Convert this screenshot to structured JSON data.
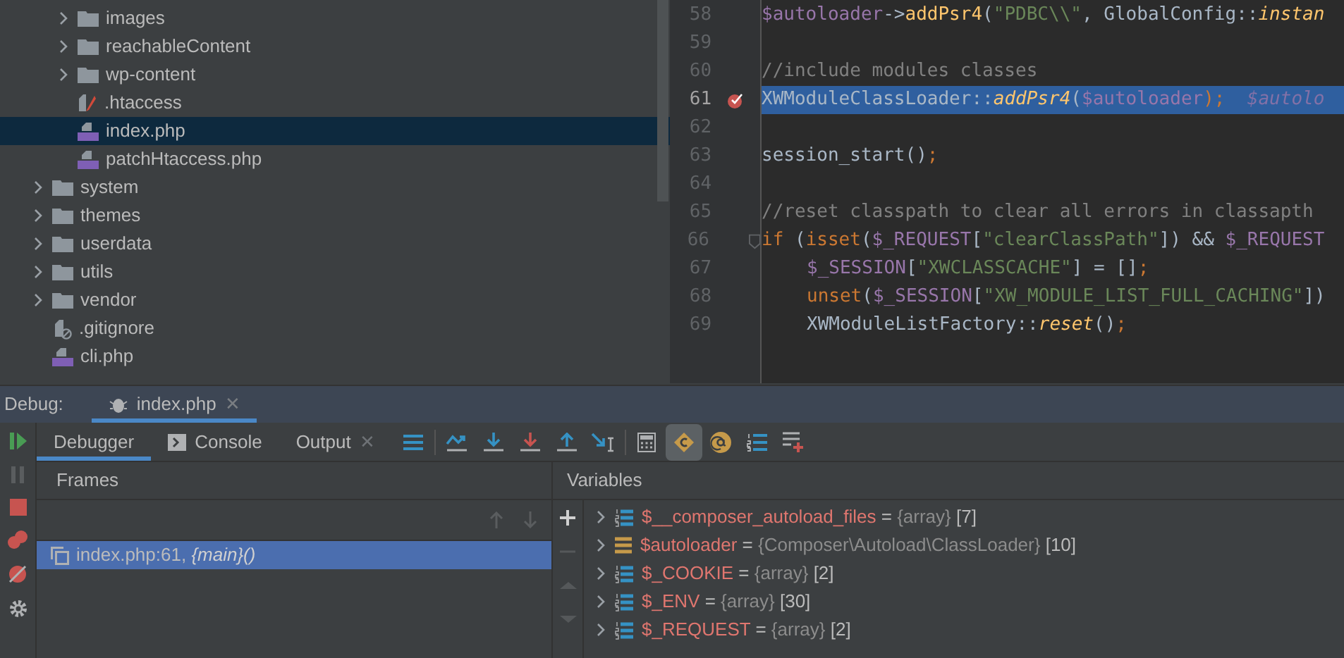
{
  "project_tree": {
    "inner_items": [
      {
        "label": "images",
        "kind": "folder",
        "expanded": false,
        "selected": false
      },
      {
        "label": "reachableContent",
        "kind": "folder",
        "expanded": false,
        "selected": false
      },
      {
        "label": "wp-content",
        "kind": "folder",
        "expanded": false,
        "selected": false
      },
      {
        "label": ".htaccess",
        "kind": "apache",
        "selected": false
      },
      {
        "label": "index.php",
        "kind": "php",
        "selected": true
      },
      {
        "label": "patchHtaccess.php",
        "kind": "php",
        "selected": false
      }
    ],
    "items": [
      {
        "label": "system",
        "kind": "folder",
        "expanded": false,
        "selected": false
      },
      {
        "label": "themes",
        "kind": "folder",
        "expanded": false,
        "selected": false
      },
      {
        "label": "userdata",
        "kind": "folder",
        "expanded": false,
        "selected": false
      },
      {
        "label": "utils",
        "kind": "folder",
        "expanded": false,
        "selected": false
      },
      {
        "label": "vendor",
        "kind": "folder",
        "expanded": false,
        "selected": false
      },
      {
        "label": ".gitignore",
        "kind": "ignore",
        "selected": false
      },
      {
        "label": "cli.php",
        "kind": "php",
        "selected": false
      }
    ]
  },
  "editor": {
    "lines": [
      {
        "number": "58",
        "current": false,
        "breakpoint": false,
        "fold": false,
        "indent": false,
        "tokens": [
          {
            "text": "$autoloader",
            "kind": "var"
          },
          {
            "text": "->",
            "kind": "plain"
          },
          {
            "text": "addPsr4",
            "kind": "call"
          },
          {
            "text": "(",
            "kind": "plain"
          },
          {
            "text": "\"PDBC\\\\\"",
            "kind": "string"
          },
          {
            "text": ", GlobalConfig::",
            "kind": "plain"
          },
          {
            "text": "instan",
            "kind": "func"
          }
        ]
      },
      {
        "number": "59",
        "current": false,
        "breakpoint": false,
        "fold": false
      },
      {
        "number": "60",
        "current": false,
        "breakpoint": false,
        "fold": false,
        "indent": false,
        "tokens": [
          {
            "text": "//include modules classes",
            "kind": "comment"
          }
        ]
      },
      {
        "number": "61",
        "current": true,
        "breakpoint": true,
        "fold": false,
        "indent": false,
        "tokens": [
          {
            "text": "XWModuleClassLoader::",
            "kind": "plain"
          },
          {
            "text": "addPsr4",
            "kind": "func"
          },
          {
            "text": "(",
            "kind": "plain"
          },
          {
            "text": "$autoloader",
            "kind": "var"
          },
          {
            "text": ");",
            "kind": "keyword"
          },
          {
            "text": "  $autolo",
            "kind": "hint"
          }
        ]
      },
      {
        "number": "62",
        "current": false,
        "breakpoint": false,
        "fold": false
      },
      {
        "number": "63",
        "current": false,
        "breakpoint": false,
        "fold": false,
        "indent": false,
        "tokens": [
          {
            "text": "session_start()",
            "kind": "plain"
          },
          {
            "text": ";",
            "kind": "keyword"
          }
        ]
      },
      {
        "number": "64",
        "current": false,
        "breakpoint": false,
        "fold": false
      },
      {
        "number": "65",
        "current": false,
        "breakpoint": false,
        "fold": false,
        "indent": false,
        "tokens": [
          {
            "text": "//reset classpath to clear all errors in classapth",
            "kind": "comment"
          }
        ]
      },
      {
        "number": "66",
        "current": false,
        "breakpoint": false,
        "fold": true,
        "indent": false,
        "tokens": [
          {
            "text": "if ",
            "kind": "keyword"
          },
          {
            "text": "(",
            "kind": "plain"
          },
          {
            "text": "isset",
            "kind": "keyword"
          },
          {
            "text": "(",
            "kind": "plain"
          },
          {
            "text": "$_REQUEST",
            "kind": "var"
          },
          {
            "text": "[",
            "kind": "plain"
          },
          {
            "text": "\"clearClassPath\"",
            "kind": "string"
          },
          {
            "text": "]) && ",
            "kind": "plain"
          },
          {
            "text": "$_REQUEST",
            "kind": "var"
          }
        ]
      },
      {
        "number": "67",
        "current": false,
        "breakpoint": false,
        "fold": false,
        "indent": true,
        "tokens": [
          {
            "text": "$_SESSION",
            "kind": "var"
          },
          {
            "text": "[",
            "kind": "plain"
          },
          {
            "text": "\"XWCLASSCACHE\"",
            "kind": "string"
          },
          {
            "text": "] = []",
            "kind": "plain"
          },
          {
            "text": ";",
            "kind": "keyword"
          }
        ]
      },
      {
        "number": "68",
        "current": false,
        "breakpoint": false,
        "fold": false,
        "indent": true,
        "tokens": [
          {
            "text": "unset",
            "kind": "keyword"
          },
          {
            "text": "(",
            "kind": "plain"
          },
          {
            "text": "$_SESSION",
            "kind": "var"
          },
          {
            "text": "[",
            "kind": "plain"
          },
          {
            "text": "\"XW_MODULE_LIST_FULL_CACHING\"",
            "kind": "string"
          },
          {
            "text": "])",
            "kind": "plain"
          }
        ]
      },
      {
        "number": "69",
        "current": false,
        "breakpoint": false,
        "fold": false,
        "indent": true,
        "tokens": [
          {
            "text": "XWModuleListFactory::",
            "kind": "plain"
          },
          {
            "text": "reset",
            "kind": "func"
          },
          {
            "text": "()",
            "kind": "plain"
          },
          {
            "text": ";",
            "kind": "keyword"
          }
        ]
      }
    ]
  },
  "debug": {
    "label": "Debug:",
    "session_tab": {
      "label": "index.php",
      "close": "✕",
      "selected": true
    },
    "tabs": [
      {
        "label": "Debugger",
        "kind": "plain",
        "selected": true
      },
      {
        "label": "Console",
        "kind": "console",
        "selected": false
      },
      {
        "label": "Output",
        "kind": "closable",
        "close": "✕",
        "selected": false
      }
    ],
    "frames": {
      "title": "Frames",
      "rows": [
        {
          "file": "index.php:61, ",
          "scope": "{main}()",
          "selected": true
        }
      ]
    },
    "variables": {
      "title": "Variables",
      "rows": [
        {
          "name": "$__composer_autoload_files",
          "op": "=",
          "type": "{array}",
          "count": "[7]",
          "kind": "array"
        },
        {
          "name": "$autoloader",
          "op": "=",
          "type": "{Composer\\Autoload\\ClassLoader}",
          "count": "[10]",
          "kind": "object"
        },
        {
          "name": "$_COOKIE",
          "op": "=",
          "type": "{array}",
          "count": "[2]",
          "kind": "array"
        },
        {
          "name": "$_ENV",
          "op": "=",
          "type": "{array}",
          "count": "[30]",
          "kind": "array"
        },
        {
          "name": "$_REQUEST",
          "op": "=",
          "type": "{array}",
          "count": "[2]",
          "kind": "array"
        }
      ]
    }
  }
}
